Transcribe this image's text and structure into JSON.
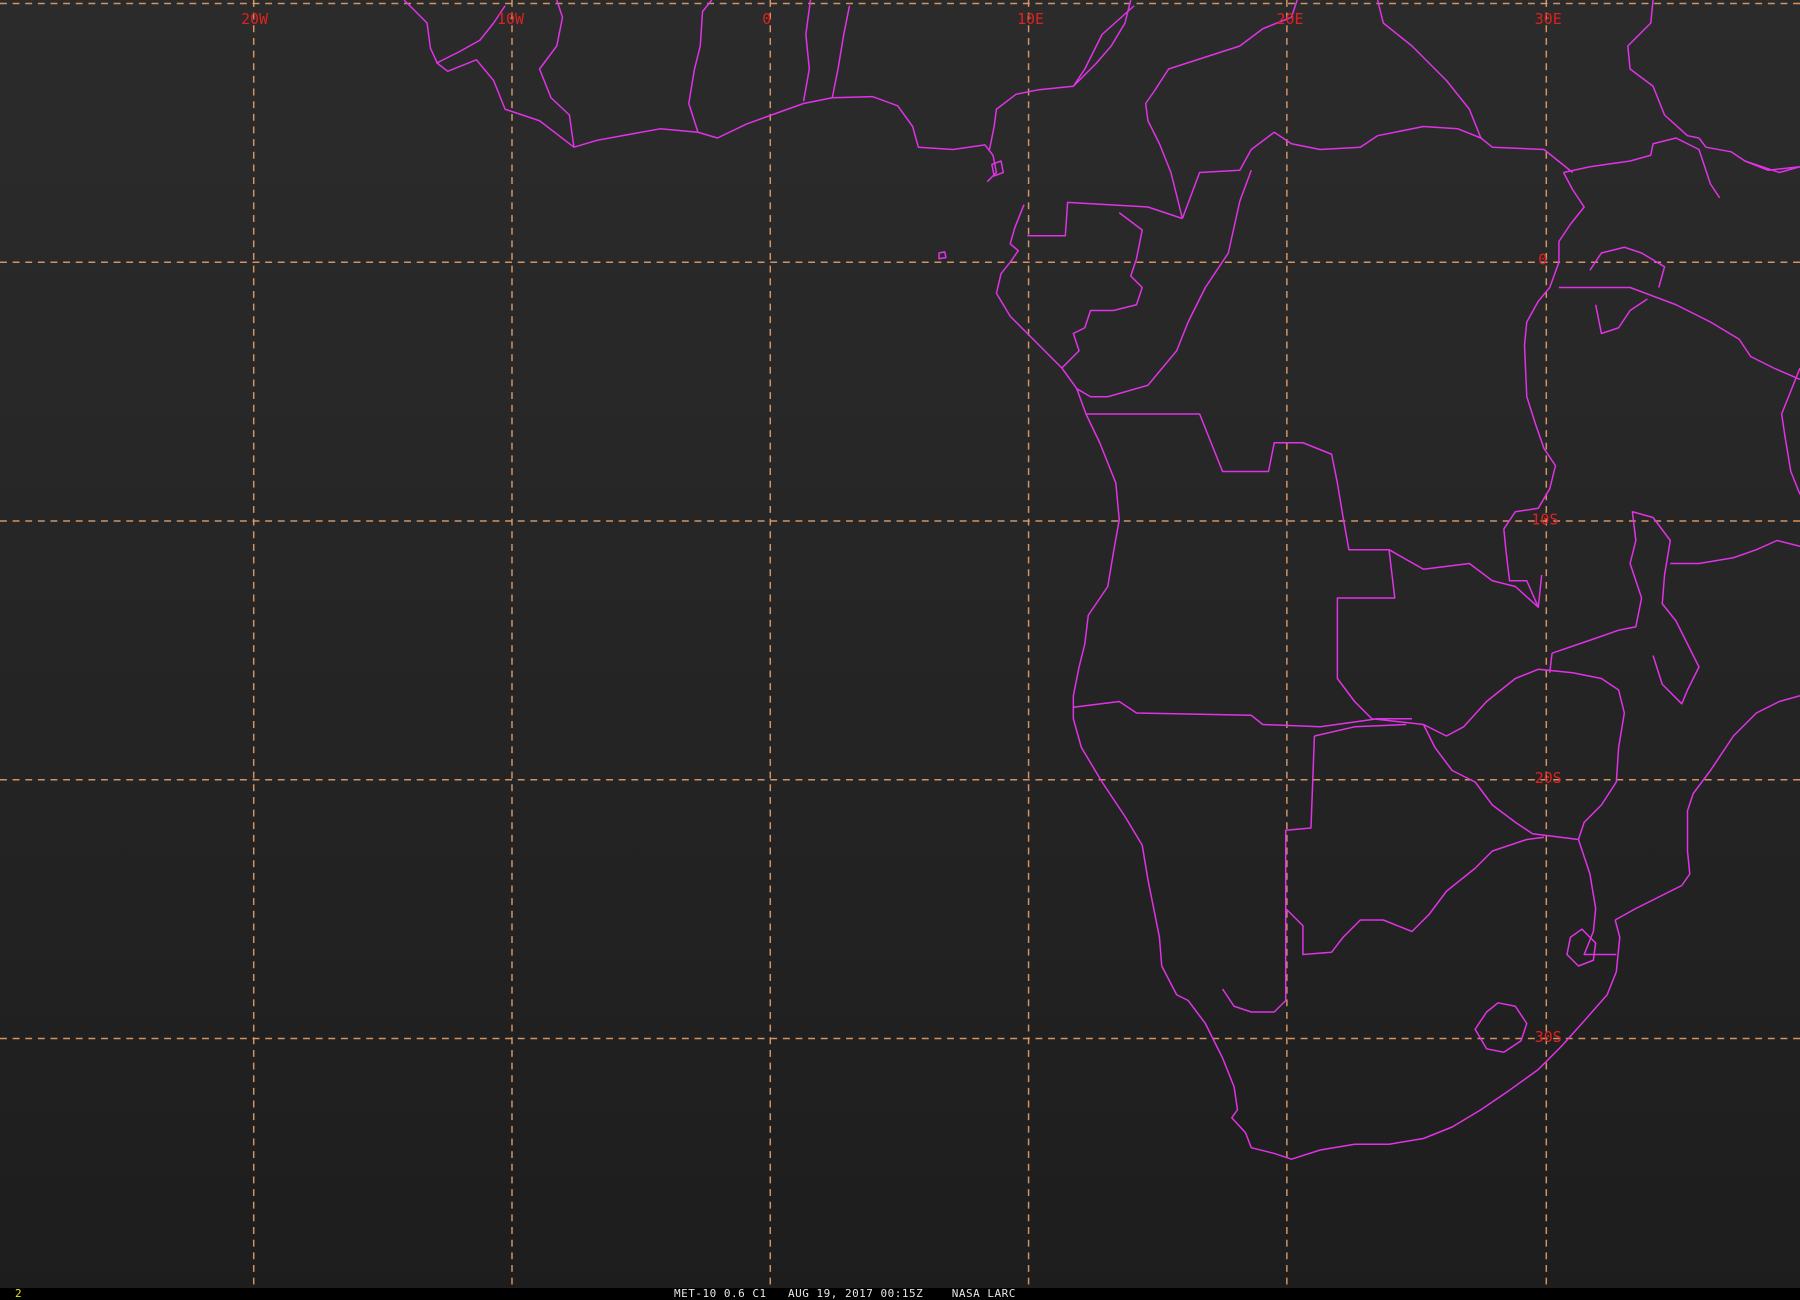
{
  "map": {
    "longitude_labels": [
      "20W",
      "10W",
      "0",
      "10E",
      "20E",
      "30E"
    ],
    "latitude_labels": [
      "0",
      "10S",
      "20S",
      "30S"
    ],
    "colors": {
      "graticule": "#e6a06a",
      "graticule_label": "#dd2222",
      "boundaries": "#e033e6",
      "background": "#262626"
    }
  },
  "status_bar": {
    "frame_number": "2",
    "caption": "MET-10 0.6 C1   AUG 19, 2017 00:15Z    NASA LARC"
  }
}
